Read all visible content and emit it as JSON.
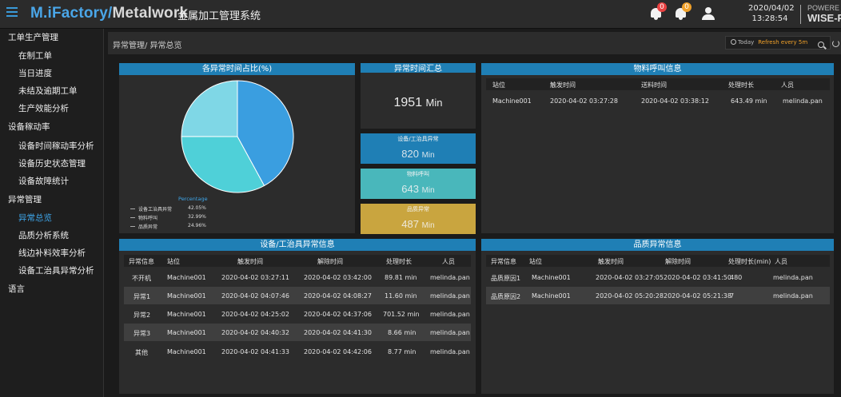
{
  "header": {
    "brand_main": "M.iFactory/",
    "brand_sub": "Metalwork",
    "system_name": "金属加工管理系统",
    "alarm_badge": "0",
    "notice_badge": "0",
    "date": "2020/04/02",
    "time": "13:28:54",
    "powered_line1": "POWERE",
    "powered_line2": "WISE-P"
  },
  "sidebar": {
    "groups": [
      {
        "label": "工单生产管理",
        "items": [
          "在制工单",
          "当日进度",
          "未结及逾期工单",
          "生产效能分析"
        ]
      },
      {
        "label": "设备稼动率",
        "items": [
          "设备时间稼动率分析",
          "设备历史状态管理",
          "设备故障统计"
        ]
      },
      {
        "label": "异常管理",
        "items": [
          "异常总览",
          "品质分析系统",
          "线边补料效率分析",
          "设备工治具异常分析"
        ]
      },
      {
        "label": "语言",
        "items": []
      }
    ]
  },
  "breadcrumb": "异常管理/ 异常总览",
  "toolbar": {
    "today": "Today",
    "refresh": "Refresh every 5m"
  },
  "pie_panel": {
    "title": "各异常时间占比(%)",
    "legend_title": "Percentage",
    "slices": [
      {
        "name": "设备工治具异常",
        "percent": 42.05,
        "label": "42.05%",
        "color": "#3a9ee0"
      },
      {
        "name": "物料呼叫",
        "percent": 32.99,
        "label": "32.99%",
        "color": "#4fd0d8"
      },
      {
        "name": "品质异常",
        "percent": 24.96,
        "label": "24.96%",
        "color": "#7fd7e6"
      }
    ]
  },
  "summary": {
    "title": "异常时间汇总",
    "total_value": "1951",
    "unit": "Min",
    "boxes": [
      {
        "label": "设备/工治具异常",
        "value": "820",
        "unit": "Min"
      },
      {
        "label": "物料呼叫",
        "value": "643",
        "unit": "Min"
      },
      {
        "label": "品质异常",
        "value": "487",
        "unit": "Min"
      }
    ]
  },
  "material_call": {
    "title": "物料呼叫信息",
    "columns": [
      "站位",
      "触发时间",
      "送料时间",
      "处理时长",
      "人员"
    ],
    "rows": [
      [
        "Machine001",
        "2020-04-02 03:27:28",
        "2020-04-02 03:38:12",
        "643.49 min",
        "melinda.pan"
      ]
    ]
  },
  "equipment": {
    "title": "设备/工治具异常信息",
    "columns": [
      "异常信息",
      "站位",
      "触发时间",
      "解除时间",
      "处理时长",
      "人员"
    ],
    "rows": [
      [
        "不开机",
        "Machine001",
        "2020-04-02 03:27:11",
        "2020-04-02 03:42:00",
        "89.81 min",
        "melinda.pan"
      ],
      [
        "异常1",
        "Machine001",
        "2020-04-02 04:07:46",
        "2020-04-02 04:08:27",
        "11.60 min",
        "melinda.pan"
      ],
      [
        "异常2",
        "Machine001",
        "2020-04-02 04:25:02",
        "2020-04-02 04:37:06",
        "701.52 min",
        "melinda.pan"
      ],
      [
        "异常3",
        "Machine001",
        "2020-04-02 04:40:32",
        "2020-04-02 04:41:30",
        "8.66 min",
        "melinda.pan"
      ],
      [
        "其他",
        "Machine001",
        "2020-04-02 04:41:33",
        "2020-04-02 04:42:06",
        "8.77 min",
        "melinda.pan"
      ]
    ]
  },
  "quality": {
    "title": "品质异常信息",
    "columns": [
      "异常信息",
      "站位",
      "触发时间",
      "解除时间",
      "处理时长(min)",
      "人员"
    ],
    "rows": [
      [
        "品质原因1",
        "Machine001",
        "2020-04-02 03:27:05",
        "2020-04-02 03:41:50",
        "480",
        "melinda.pan"
      ],
      [
        "品质原因2",
        "Machine001",
        "2020-04-02 05:20:28",
        "2020-04-02 05:21:38",
        "7",
        "melinda.pan"
      ]
    ]
  }
}
